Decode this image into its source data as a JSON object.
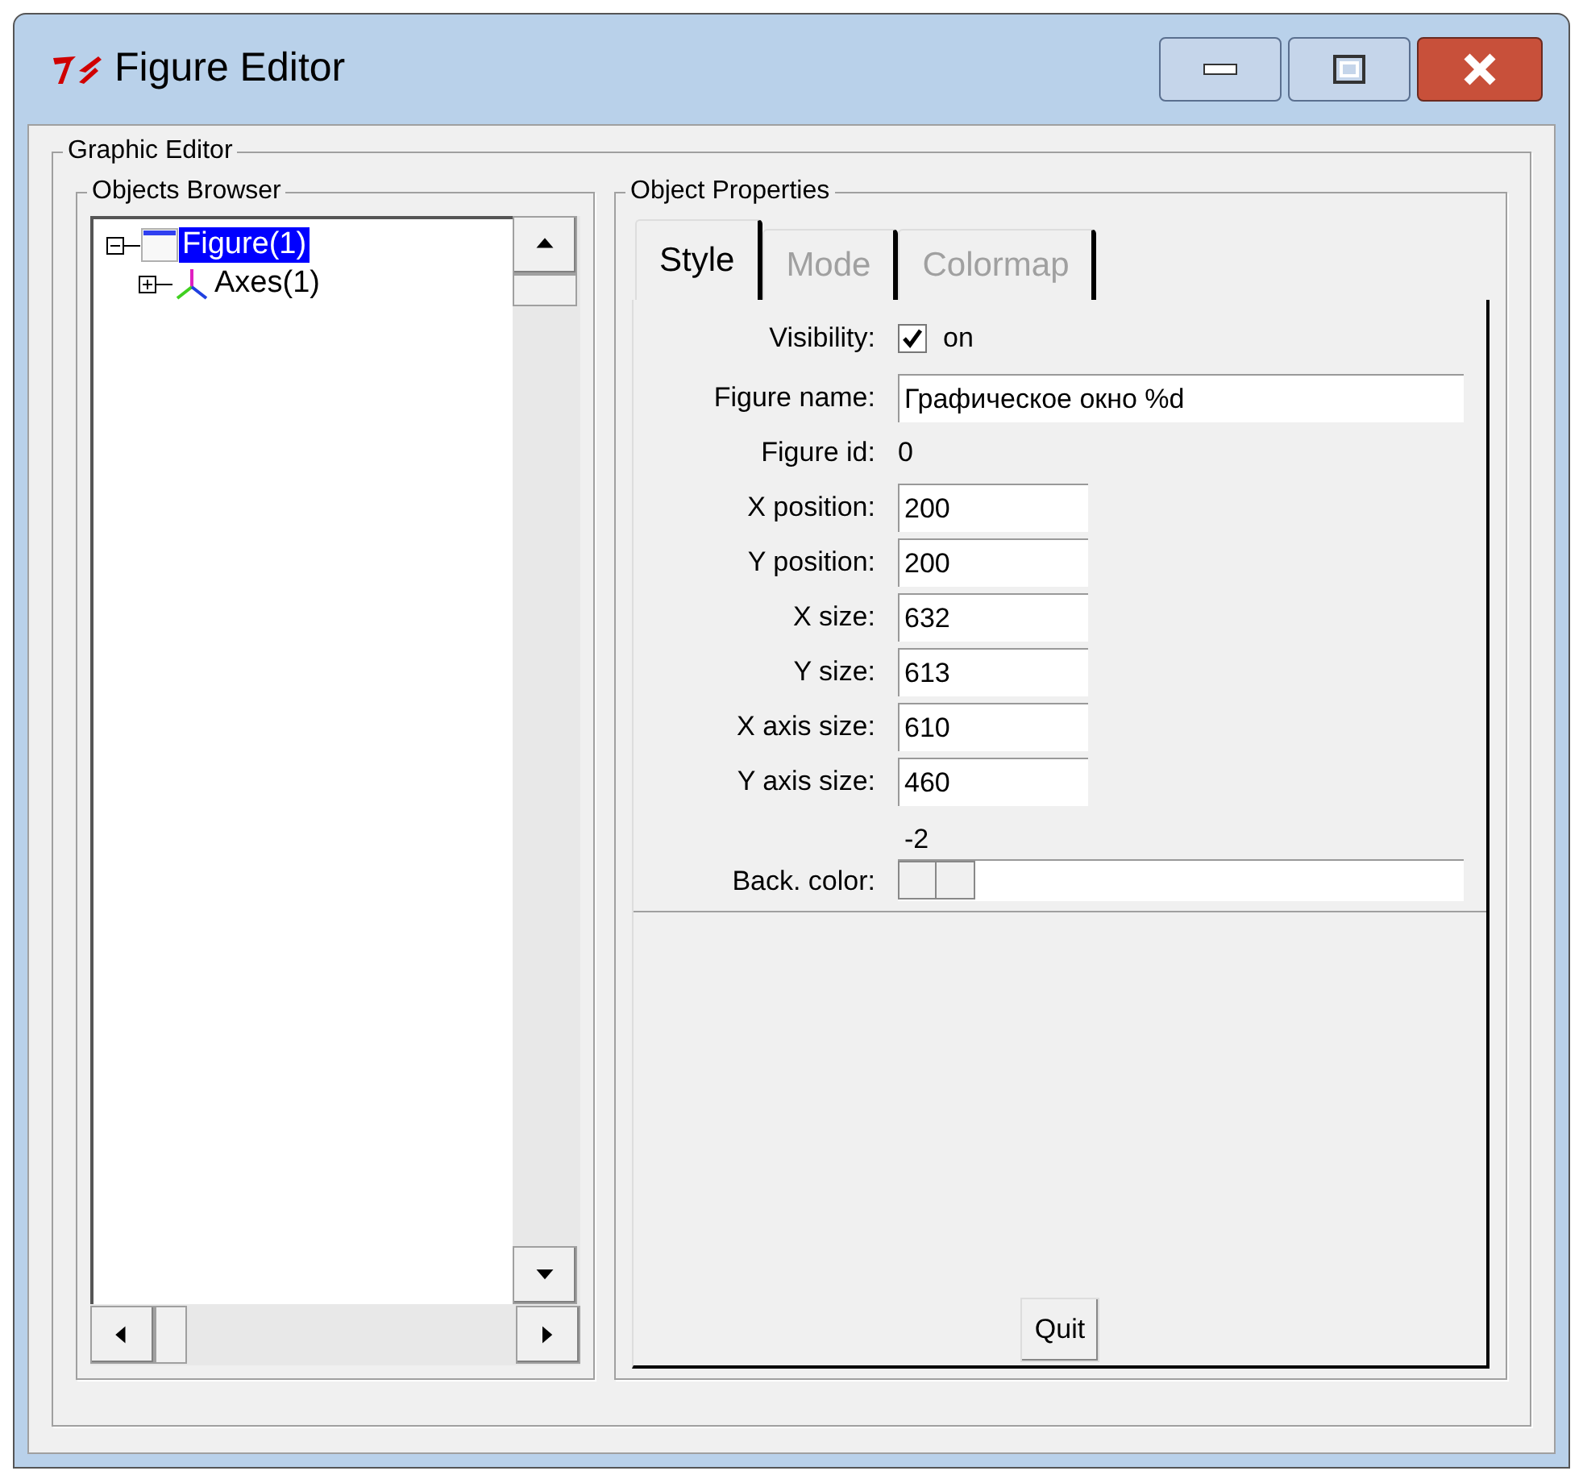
{
  "window": {
    "title": "Figure Editor"
  },
  "graphic_editor": {
    "title": "Graphic Editor"
  },
  "objects_browser": {
    "title": "Objects Browser",
    "tree": [
      {
        "label": "Figure(1)",
        "expanded": true,
        "selected": true,
        "children": [
          {
            "label": "Axes(1)",
            "expanded": false,
            "selected": false
          }
        ]
      }
    ]
  },
  "object_properties": {
    "title": "Object Properties",
    "tabs": [
      {
        "label": "Style",
        "selected": true
      },
      {
        "label": "Mode",
        "selected": false
      },
      {
        "label": "Colormap",
        "selected": false
      }
    ],
    "fields": [
      {
        "kind": "check",
        "label": "Visibility:",
        "checked": true,
        "text": "on"
      },
      {
        "kind": "wide",
        "label": "Figure name:",
        "value": "Графическое окно %d"
      },
      {
        "kind": "text",
        "label": "Figure id:",
        "value": "0"
      },
      {
        "kind": "entry",
        "label": "X position:",
        "value": "200"
      },
      {
        "kind": "entry",
        "label": "Y position:",
        "value": "200"
      },
      {
        "kind": "entry",
        "label": "X size:",
        "value": "632"
      },
      {
        "kind": "entry",
        "label": "Y size:",
        "value": "613"
      },
      {
        "kind": "entry",
        "label": "X axis size:",
        "value": "610"
      },
      {
        "kind": "entry",
        "label": "Y axis size:",
        "value": "460"
      },
      {
        "kind": "slider",
        "label": "Back. color:",
        "reading": "-2",
        "level": 0
      }
    ],
    "quit": "Quit"
  }
}
